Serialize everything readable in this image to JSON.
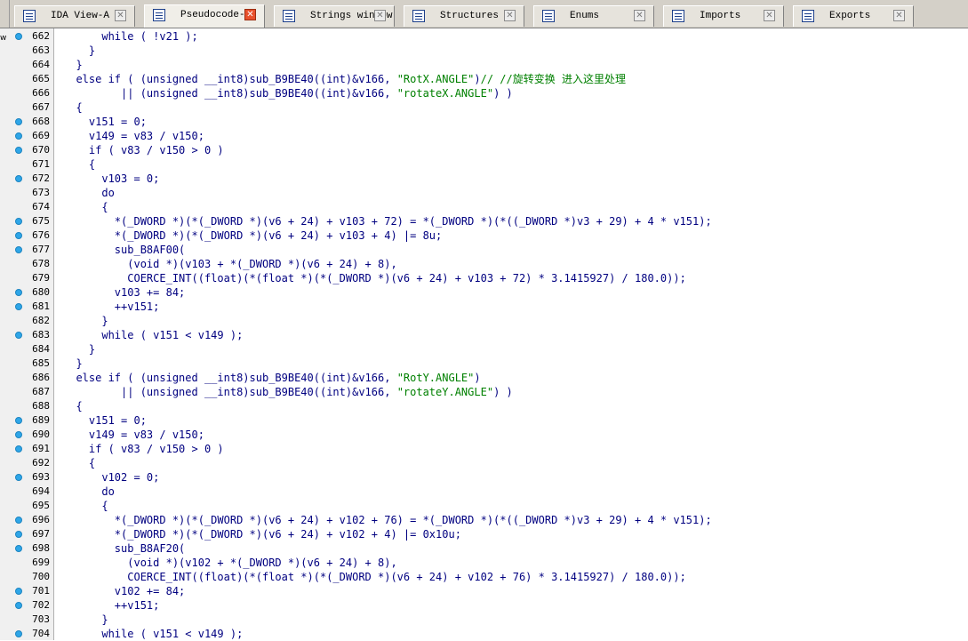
{
  "tabs": [
    {
      "label": "IDA View-A",
      "icon": "disassembly-view-icon",
      "active": false
    },
    {
      "label": "Pseudocode-A",
      "icon": "pseudocode-icon",
      "active": true
    },
    {
      "label": "Strings window",
      "icon": "strings-icon",
      "active": false
    },
    {
      "label": "Structures",
      "icon": "structures-icon",
      "active": false
    },
    {
      "label": "Enums",
      "icon": "enums-icon",
      "active": false
    },
    {
      "label": "Imports",
      "icon": "imports-icon",
      "active": false
    },
    {
      "label": "Exports",
      "icon": "exports-icon",
      "active": false
    }
  ],
  "tab_close_glyph": "✕",
  "gutter_edge_text": "w",
  "colors": {
    "keyword_text": "#000080",
    "string_and_comment": "#008000",
    "breakpoint_dot": "#2ea6e8",
    "active_tab_close": "#e8502c"
  },
  "lines": [
    {
      "num": "662",
      "dot": true,
      "code": "      while ( !v21 );"
    },
    {
      "num": "663",
      "dot": false,
      "code": "    }"
    },
    {
      "num": "664",
      "dot": false,
      "code": "  }"
    },
    {
      "num": "665",
      "dot": false,
      "code": "  else if ( (unsigned __int8)sub_B9BE40((int)&v166, \"RotX.ANGLE\")",
      "comment": "// //旋转变换 进入这里处理"
    },
    {
      "num": "666",
      "dot": false,
      "code": "         || (unsigned __int8)sub_B9BE40((int)&v166, \"rotateX.ANGLE\") )"
    },
    {
      "num": "667",
      "dot": false,
      "code": "  {"
    },
    {
      "num": "668",
      "dot": true,
      "code": "    v151 = 0;"
    },
    {
      "num": "669",
      "dot": true,
      "code": "    v149 = v83 / v150;"
    },
    {
      "num": "670",
      "dot": true,
      "code": "    if ( v83 / v150 > 0 )"
    },
    {
      "num": "671",
      "dot": false,
      "code": "    {"
    },
    {
      "num": "672",
      "dot": true,
      "code": "      v103 = 0;"
    },
    {
      "num": "673",
      "dot": false,
      "code": "      do"
    },
    {
      "num": "674",
      "dot": false,
      "code": "      {"
    },
    {
      "num": "675",
      "dot": true,
      "code": "        *(_DWORD *)(*(_DWORD *)(v6 + 24) + v103 + 72) = *(_DWORD *)(*((_DWORD *)v3 + 29) + 4 * v151);"
    },
    {
      "num": "676",
      "dot": true,
      "code": "        *(_DWORD *)(*(_DWORD *)(v6 + 24) + v103 + 4) |= 8u;"
    },
    {
      "num": "677",
      "dot": true,
      "code": "        sub_B8AF00("
    },
    {
      "num": "678",
      "dot": false,
      "code": "          (void *)(v103 + *(_DWORD *)(v6 + 24) + 8),"
    },
    {
      "num": "679",
      "dot": false,
      "code": "          COERCE_INT((float)(*(float *)(*(_DWORD *)(v6 + 24) + v103 + 72) * 3.1415927) / 180.0));"
    },
    {
      "num": "680",
      "dot": true,
      "code": "        v103 += 84;"
    },
    {
      "num": "681",
      "dot": true,
      "code": "        ++v151;"
    },
    {
      "num": "682",
      "dot": false,
      "code": "      }"
    },
    {
      "num": "683",
      "dot": true,
      "code": "      while ( v151 < v149 );"
    },
    {
      "num": "684",
      "dot": false,
      "code": "    }"
    },
    {
      "num": "685",
      "dot": false,
      "code": "  }"
    },
    {
      "num": "686",
      "dot": false,
      "code": "  else if ( (unsigned __int8)sub_B9BE40((int)&v166, \"RotY.ANGLE\")"
    },
    {
      "num": "687",
      "dot": false,
      "code": "         || (unsigned __int8)sub_B9BE40((int)&v166, \"rotateY.ANGLE\") )"
    },
    {
      "num": "688",
      "dot": false,
      "code": "  {"
    },
    {
      "num": "689",
      "dot": true,
      "code": "    v151 = 0;"
    },
    {
      "num": "690",
      "dot": true,
      "code": "    v149 = v83 / v150;"
    },
    {
      "num": "691",
      "dot": true,
      "code": "    if ( v83 / v150 > 0 )"
    },
    {
      "num": "692",
      "dot": false,
      "code": "    {"
    },
    {
      "num": "693",
      "dot": true,
      "code": "      v102 = 0;"
    },
    {
      "num": "694",
      "dot": false,
      "code": "      do"
    },
    {
      "num": "695",
      "dot": false,
      "code": "      {"
    },
    {
      "num": "696",
      "dot": true,
      "code": "        *(_DWORD *)(*(_DWORD *)(v6 + 24) + v102 + 76) = *(_DWORD *)(*((_DWORD *)v3 + 29) + 4 * v151);"
    },
    {
      "num": "697",
      "dot": true,
      "code": "        *(_DWORD *)(*(_DWORD *)(v6 + 24) + v102 + 4) |= 0x10u;"
    },
    {
      "num": "698",
      "dot": true,
      "code": "        sub_B8AF20("
    },
    {
      "num": "699",
      "dot": false,
      "code": "          (void *)(v102 + *(_DWORD *)(v6 + 24) + 8),"
    },
    {
      "num": "700",
      "dot": false,
      "code": "          COERCE_INT((float)(*(float *)(*(_DWORD *)(v6 + 24) + v102 + 76) * 3.1415927) / 180.0));"
    },
    {
      "num": "701",
      "dot": true,
      "code": "        v102 += 84;"
    },
    {
      "num": "702",
      "dot": true,
      "code": "        ++v151;"
    },
    {
      "num": "703",
      "dot": false,
      "code": "      }"
    },
    {
      "num": "704",
      "dot": true,
      "code": "      while ( v151 < v149 );"
    }
  ]
}
